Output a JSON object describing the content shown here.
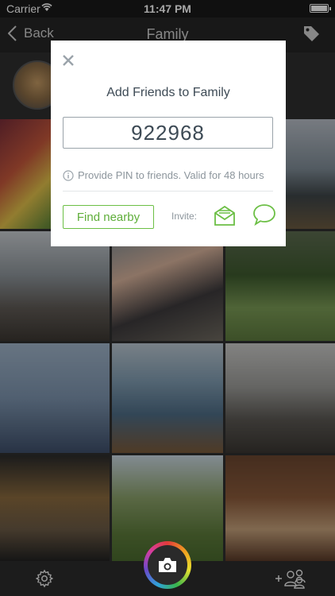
{
  "status_bar": {
    "carrier": "Carrier",
    "time": "11:47 PM"
  },
  "nav": {
    "back_label": "Back",
    "title": "Family"
  },
  "modal": {
    "title": "Add Friends to Family",
    "pin": "922968",
    "hint": "Provide PIN to friends. Valid for 48 hours",
    "find_nearby": "Find nearby",
    "invite_label": "Invite:"
  },
  "colors": {
    "accent_green": "#5fae3a",
    "text_dark": "#3d4a55",
    "text_muted": "#8c959c"
  }
}
